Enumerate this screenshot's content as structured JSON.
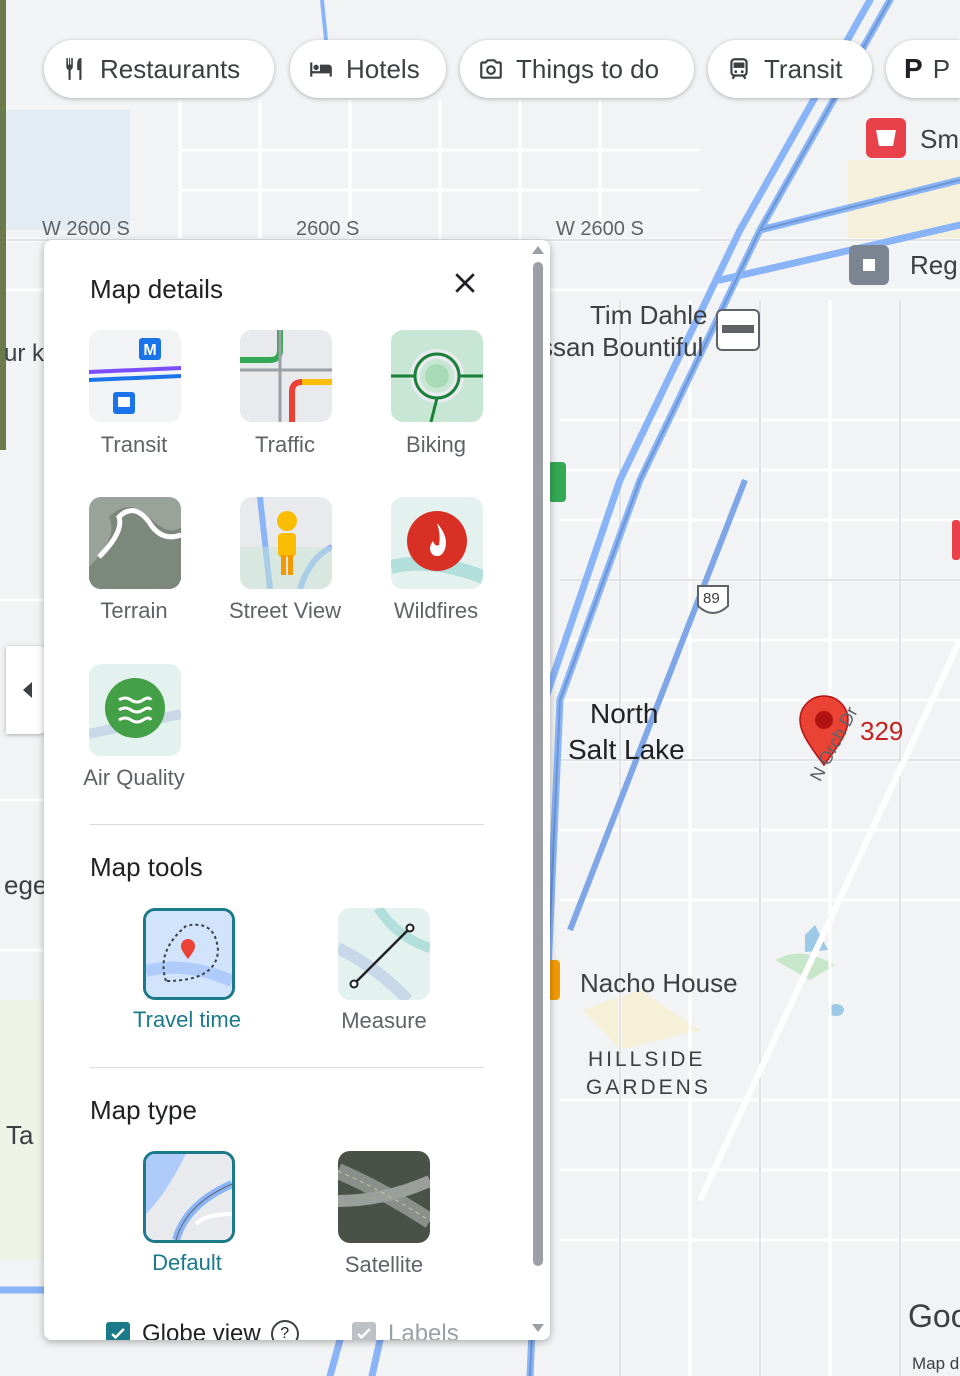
{
  "chips": [
    {
      "label": "Restaurants",
      "icon": "fork-knife-icon"
    },
    {
      "label": "Hotels",
      "icon": "bed-icon"
    },
    {
      "label": "Things to do",
      "icon": "camera-icon"
    },
    {
      "label": "Transit",
      "icon": "train-icon"
    },
    {
      "label": "P",
      "icon": "parking-icon"
    }
  ],
  "map": {
    "street_labels": [
      "W 2600 S",
      "2600 S",
      "W 2600 S",
      "N Orch Dr"
    ],
    "places": {
      "tim_dahle_line1": "Tim Dahle",
      "tim_dahle_line2": "ssan Bountiful",
      "north_salt_lake_line1": "North",
      "north_salt_lake_line2": "Salt Lake",
      "nacho_house": "Nacho House",
      "hillside_line1": "HILLSIDE",
      "hillside_line2": "GARDENS",
      "pin_number": "329",
      "route_shield": "89",
      "edge_sm": "Sm",
      "edge_reg": "Reg",
      "edge_ur": "ur k",
      "edge_ege": "ege",
      "edge_ta": "Ta",
      "google": "Goo",
      "map_data": "Map d"
    },
    "colors": {
      "pin": "#ea4335",
      "highway": "#8ab4f8",
      "accent": "#1a7a8a"
    }
  },
  "panel": {
    "details_title": "Map details",
    "details": [
      {
        "label": "Transit",
        "icon": "transit-layer-icon"
      },
      {
        "label": "Traffic",
        "icon": "traffic-layer-icon"
      },
      {
        "label": "Biking",
        "icon": "biking-layer-icon"
      },
      {
        "label": "Terrain",
        "icon": "terrain-layer-icon"
      },
      {
        "label": "Street View",
        "icon": "street-view-icon"
      },
      {
        "label": "Wildfires",
        "icon": "wildfire-icon"
      },
      {
        "label": "Air Quality",
        "icon": "air-quality-icon"
      }
    ],
    "tools_title": "Map tools",
    "tools": [
      {
        "label": "Travel time",
        "selected": true,
        "icon": "travel-time-icon"
      },
      {
        "label": "Measure",
        "selected": false,
        "icon": "measure-icon"
      }
    ],
    "type_title": "Map type",
    "types": [
      {
        "label": "Default",
        "selected": true,
        "icon": "default-map-icon"
      },
      {
        "label": "Satellite",
        "selected": false,
        "icon": "satellite-map-icon"
      }
    ],
    "globe_view_label": "Globe view",
    "globe_view_checked": true,
    "labels_label": "Labels",
    "labels_checked": true
  }
}
